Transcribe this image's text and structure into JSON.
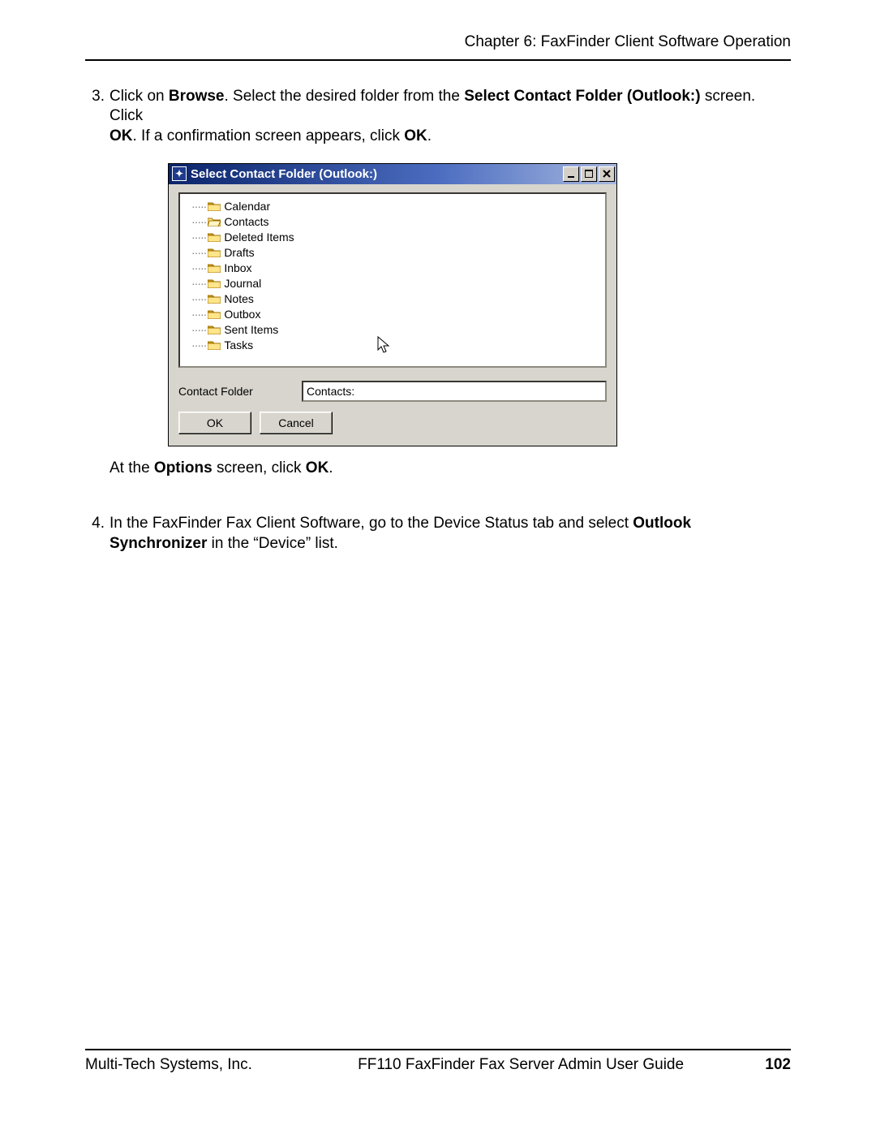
{
  "header": {
    "chapter": "Chapter 6:  FaxFinder Client Software Operation"
  },
  "steps": {
    "s3_num": "3.",
    "s3_p1_a": "Click on ",
    "s3_p1_b": "Browse",
    "s3_p1_c": ". Select the desired folder from the ",
    "s3_p1_d": "Select Contact Folder (Outlook:)",
    "s3_p1_e": " screen.  Click ",
    "s3_p2_a": "OK",
    "s3_p2_b": ".  If a confirmation screen appears, click ",
    "s3_p2_c": "OK",
    "s3_p2_d": ".",
    "after_a": "At the ",
    "after_b": "Options",
    "after_c": " screen, click ",
    "after_d": "OK",
    "after_e": ".",
    "s4_num": "4.",
    "s4_a": "In the FaxFinder Fax Client Software, go to the Device Status tab and select ",
    "s4_b": "Outlook Synchronizer",
    "s4_c": " in the “Device” list."
  },
  "dialog": {
    "title": "Select Contact Folder (Outlook:)",
    "tree": {
      "items": [
        {
          "label": "Calendar",
          "open": false
        },
        {
          "label": "Contacts",
          "open": true
        },
        {
          "label": "Deleted Items",
          "open": false
        },
        {
          "label": "Drafts",
          "open": false
        },
        {
          "label": "Inbox",
          "open": false
        },
        {
          "label": "Journal",
          "open": false
        },
        {
          "label": "Notes",
          "open": false
        },
        {
          "label": "Outbox",
          "open": false
        },
        {
          "label": "Sent Items",
          "open": false
        },
        {
          "label": "Tasks",
          "open": false
        }
      ]
    },
    "field_label": "Contact Folder",
    "field_value": "Contacts:",
    "ok": "OK",
    "cancel": "Cancel"
  },
  "footer": {
    "left": "Multi-Tech Systems, Inc.",
    "center": "FF110 FaxFinder Fax Server Admin User Guide",
    "page": "102"
  }
}
